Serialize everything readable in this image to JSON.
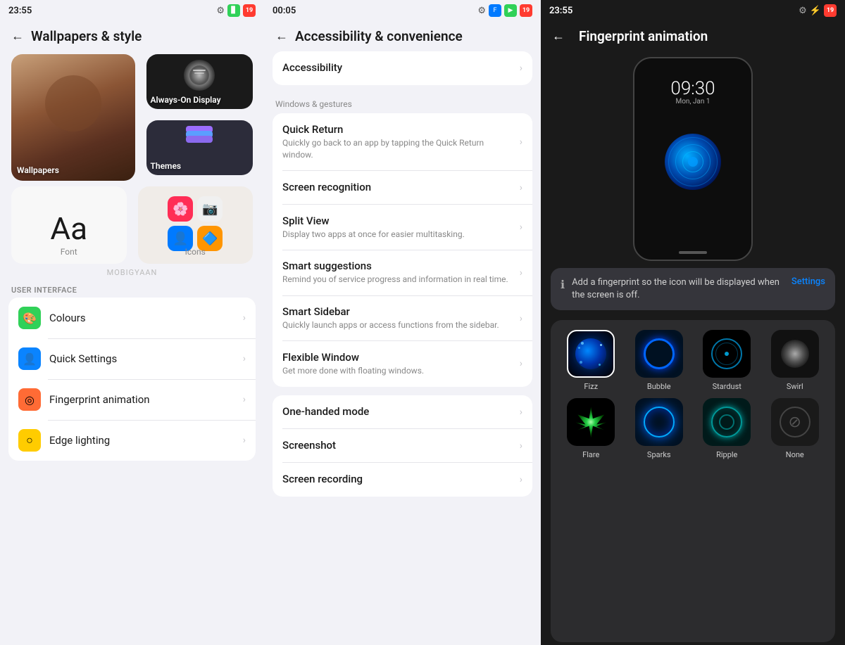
{
  "panel1": {
    "statusBar": {
      "time": "23:55",
      "settingsIcon": "⚙",
      "batteryLevel": "19"
    },
    "header": {
      "title": "Wallpapers & style",
      "backLabel": "←"
    },
    "gridItems": [
      {
        "id": "wallpapers",
        "label": "Wallpapers"
      },
      {
        "id": "always-on-display",
        "label": "Always-On Display"
      },
      {
        "id": "themes",
        "label": "Themes"
      },
      {
        "id": "font",
        "label": "Font"
      },
      {
        "id": "icons",
        "label": "Icons"
      }
    ],
    "watermark": "MOBIGYAAN",
    "sectionHeader": "USER INTERFACE",
    "listItems": [
      {
        "id": "colours",
        "label": "Colours",
        "iconColor": "#30d158",
        "iconSymbol": "🎨"
      },
      {
        "id": "quick-settings",
        "label": "Quick Settings",
        "iconColor": "#0a84ff",
        "iconSymbol": "👤"
      },
      {
        "id": "fingerprint-animation",
        "label": "Fingerprint animation",
        "iconColor": "#ff6b35",
        "iconSymbol": "◎"
      },
      {
        "id": "edge-lighting",
        "label": "Edge lighting",
        "iconColor": "#ffcc00",
        "iconSymbol": "○"
      }
    ]
  },
  "panel2": {
    "statusBar": {
      "time": "00:05",
      "batteryLevel": "19"
    },
    "header": {
      "title": "Accessibility & convenience",
      "backLabel": "←"
    },
    "items": [
      {
        "id": "accessibility",
        "title": "Accessibility",
        "description": ""
      }
    ],
    "sectionLabel": "Windows & gestures",
    "listItems": [
      {
        "id": "quick-return",
        "title": "Quick Return",
        "description": "Quickly go back to an app by tapping the Quick Return window."
      },
      {
        "id": "screen-recognition",
        "title": "Screen recognition",
        "description": ""
      },
      {
        "id": "split-view",
        "title": "Split View",
        "description": "Display two apps at once for easier multitasking."
      },
      {
        "id": "smart-suggestions",
        "title": "Smart suggestions",
        "description": "Remind you of service progress and information in real time."
      },
      {
        "id": "smart-sidebar",
        "title": "Smart Sidebar",
        "description": "Quickly launch apps or access functions from the sidebar."
      },
      {
        "id": "flexible-window",
        "title": "Flexible Window",
        "description": "Get more done with floating windows."
      }
    ],
    "bottomItems": [
      {
        "id": "one-handed-mode",
        "title": "One-handed mode",
        "description": ""
      },
      {
        "id": "screenshot",
        "title": "Screenshot",
        "description": ""
      },
      {
        "id": "screen-recording",
        "title": "Screen recording",
        "description": ""
      }
    ]
  },
  "panel3": {
    "statusBar": {
      "time": "23:55",
      "batteryLevel": "19"
    },
    "header": {
      "title": "Fingerprint animation",
      "backLabel": "←"
    },
    "phonePreview": {
      "time": "09:30",
      "date": "Mon, Jan 1"
    },
    "infoBanner": {
      "text": "Add a fingerprint so the icon will be displayed when the screen is off.",
      "settingsLabel": "Settings"
    },
    "animations": [
      {
        "id": "fizz",
        "label": "Fizz",
        "selected": true
      },
      {
        "id": "bubble",
        "label": "Bubble",
        "selected": false
      },
      {
        "id": "stardust",
        "label": "Stardust",
        "selected": false
      },
      {
        "id": "swirl",
        "label": "Swirl",
        "selected": false
      },
      {
        "id": "flare",
        "label": "Flare",
        "selected": false
      },
      {
        "id": "sparks",
        "label": "Sparks",
        "selected": false
      },
      {
        "id": "ripple",
        "label": "Ripple",
        "selected": false
      },
      {
        "id": "none",
        "label": "None",
        "selected": false
      }
    ]
  }
}
